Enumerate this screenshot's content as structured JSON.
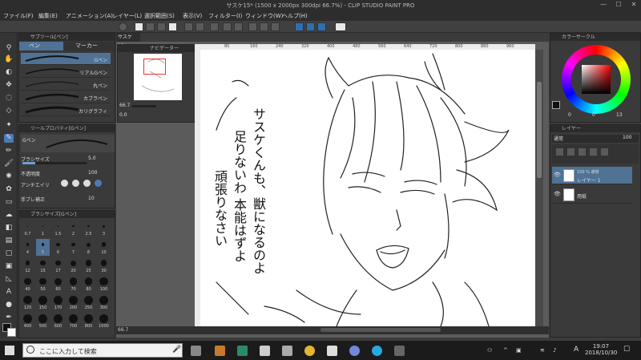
{
  "title_bar": {
    "title": "サスケ15* (1500 x 2000px 300dpi 66.7%) - CLIP STUDIO PAINT PRO",
    "minimize": "—",
    "maximize": "☐",
    "close": "✕"
  },
  "menu": [
    "ファイル(F)",
    "編集(E)",
    "アニメーション(A)",
    "レイヤー(L)",
    "選択範囲(S)",
    "表示(V)",
    "フィルター(I)",
    "ウィンドウ(W)",
    "ヘルプ(H)"
  ],
  "sub_tool": {
    "header": "サブツール[ペン]",
    "tabs": [
      "ペン",
      "マーカー"
    ],
    "brushes": [
      "Gペン",
      "リアルGペン",
      "丸ペン",
      "カブラペン",
      "カリグラフィ"
    ]
  },
  "tool_property": {
    "header": "ツールプロパティ[Gペン]",
    "brush_name": "Gペン",
    "brush_size_label": "ブラシサイズ",
    "brush_size_value": "5.0",
    "opacity_label": "不透明度",
    "opacity_value": "100",
    "antialias_label": "アンチエイリ",
    "stabilization_label": "手ブレ補正",
    "stabilization_value": "10"
  },
  "brush_size_panel": {
    "header": "ブラシサイズ[Gペン]",
    "sizes": [
      "0.7",
      "1",
      "1.5",
      "2",
      "2.5",
      "3",
      "4",
      "5",
      "6",
      "7",
      "8",
      "10",
      "12",
      "15",
      "17",
      "20",
      "25",
      "30",
      "40",
      "50",
      "60",
      "70",
      "80",
      "100",
      "120",
      "150",
      "170",
      "200",
      "250",
      "300",
      "400",
      "500",
      "600",
      "700",
      "800",
      "1000"
    ],
    "selected": "5"
  },
  "canvas_tab": "サスケ15*",
  "navigator": {
    "header": "ナビゲーター",
    "zoom": "66.7",
    "rotate": "0.0"
  },
  "canvas_text": {
    "line1": "サスケくんも、獣になるのよ",
    "line2": "足りないわ 本能はずよ",
    "line3": "頑張りなさい"
  },
  "canvas_status": {
    "zoom": "66.7"
  },
  "color_circle": {
    "header": "カラーサークル",
    "h_value": "0",
    "s_value": "0",
    "v_value": "13"
  },
  "layer_panel": {
    "header": "レイヤー",
    "blend_mode": "通常",
    "opacity": "100",
    "layers": [
      {
        "name": "レイヤー 1",
        "info": "100 % 通常"
      },
      {
        "name": "用紙",
        "info": ""
      }
    ]
  },
  "taskbar": {
    "search_placeholder": "ここに入力して検索",
    "time": "19:07",
    "date": "2018/10/30",
    "ime": "A"
  },
  "ruler_marks": [
    "80",
    "160",
    "240",
    "320",
    "400",
    "480",
    "560",
    "640",
    "720",
    "800",
    "880",
    "960",
    "1040"
  ]
}
